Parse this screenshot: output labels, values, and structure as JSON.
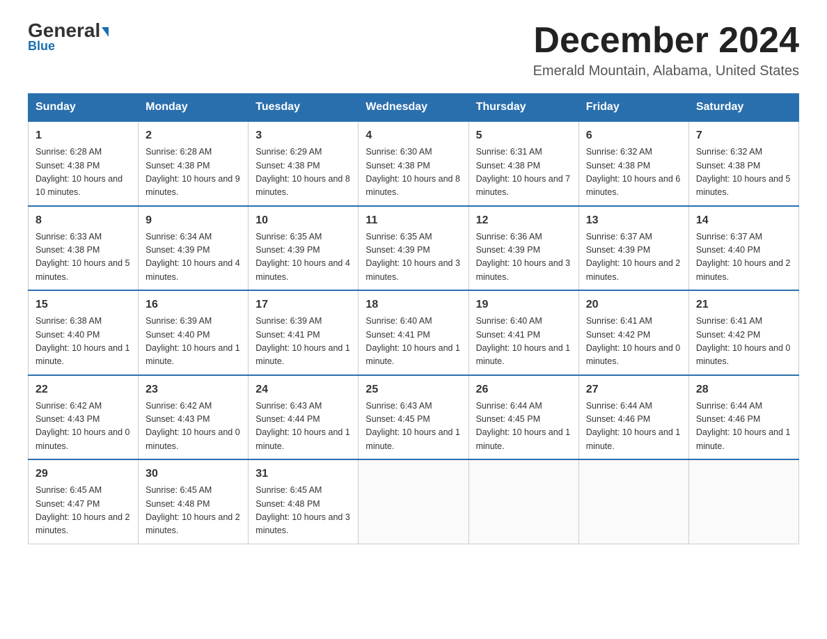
{
  "logo": {
    "general": "General",
    "triangle": "▶",
    "blue": "Blue"
  },
  "header": {
    "month_year": "December 2024",
    "location": "Emerald Mountain, Alabama, United States"
  },
  "days_of_week": [
    "Sunday",
    "Monday",
    "Tuesday",
    "Wednesday",
    "Thursday",
    "Friday",
    "Saturday"
  ],
  "weeks": [
    [
      {
        "day": "1",
        "sunrise": "6:28 AM",
        "sunset": "4:38 PM",
        "daylight": "10 hours and 10 minutes."
      },
      {
        "day": "2",
        "sunrise": "6:28 AM",
        "sunset": "4:38 PM",
        "daylight": "10 hours and 9 minutes."
      },
      {
        "day": "3",
        "sunrise": "6:29 AM",
        "sunset": "4:38 PM",
        "daylight": "10 hours and 8 minutes."
      },
      {
        "day": "4",
        "sunrise": "6:30 AM",
        "sunset": "4:38 PM",
        "daylight": "10 hours and 8 minutes."
      },
      {
        "day": "5",
        "sunrise": "6:31 AM",
        "sunset": "4:38 PM",
        "daylight": "10 hours and 7 minutes."
      },
      {
        "day": "6",
        "sunrise": "6:32 AM",
        "sunset": "4:38 PM",
        "daylight": "10 hours and 6 minutes."
      },
      {
        "day": "7",
        "sunrise": "6:32 AM",
        "sunset": "4:38 PM",
        "daylight": "10 hours and 5 minutes."
      }
    ],
    [
      {
        "day": "8",
        "sunrise": "6:33 AM",
        "sunset": "4:38 PM",
        "daylight": "10 hours and 5 minutes."
      },
      {
        "day": "9",
        "sunrise": "6:34 AM",
        "sunset": "4:39 PM",
        "daylight": "10 hours and 4 minutes."
      },
      {
        "day": "10",
        "sunrise": "6:35 AM",
        "sunset": "4:39 PM",
        "daylight": "10 hours and 4 minutes."
      },
      {
        "day": "11",
        "sunrise": "6:35 AM",
        "sunset": "4:39 PM",
        "daylight": "10 hours and 3 minutes."
      },
      {
        "day": "12",
        "sunrise": "6:36 AM",
        "sunset": "4:39 PM",
        "daylight": "10 hours and 3 minutes."
      },
      {
        "day": "13",
        "sunrise": "6:37 AM",
        "sunset": "4:39 PM",
        "daylight": "10 hours and 2 minutes."
      },
      {
        "day": "14",
        "sunrise": "6:37 AM",
        "sunset": "4:40 PM",
        "daylight": "10 hours and 2 minutes."
      }
    ],
    [
      {
        "day": "15",
        "sunrise": "6:38 AM",
        "sunset": "4:40 PM",
        "daylight": "10 hours and 1 minute."
      },
      {
        "day": "16",
        "sunrise": "6:39 AM",
        "sunset": "4:40 PM",
        "daylight": "10 hours and 1 minute."
      },
      {
        "day": "17",
        "sunrise": "6:39 AM",
        "sunset": "4:41 PM",
        "daylight": "10 hours and 1 minute."
      },
      {
        "day": "18",
        "sunrise": "6:40 AM",
        "sunset": "4:41 PM",
        "daylight": "10 hours and 1 minute."
      },
      {
        "day": "19",
        "sunrise": "6:40 AM",
        "sunset": "4:41 PM",
        "daylight": "10 hours and 1 minute."
      },
      {
        "day": "20",
        "sunrise": "6:41 AM",
        "sunset": "4:42 PM",
        "daylight": "10 hours and 0 minutes."
      },
      {
        "day": "21",
        "sunrise": "6:41 AM",
        "sunset": "4:42 PM",
        "daylight": "10 hours and 0 minutes."
      }
    ],
    [
      {
        "day": "22",
        "sunrise": "6:42 AM",
        "sunset": "4:43 PM",
        "daylight": "10 hours and 0 minutes."
      },
      {
        "day": "23",
        "sunrise": "6:42 AM",
        "sunset": "4:43 PM",
        "daylight": "10 hours and 0 minutes."
      },
      {
        "day": "24",
        "sunrise": "6:43 AM",
        "sunset": "4:44 PM",
        "daylight": "10 hours and 1 minute."
      },
      {
        "day": "25",
        "sunrise": "6:43 AM",
        "sunset": "4:45 PM",
        "daylight": "10 hours and 1 minute."
      },
      {
        "day": "26",
        "sunrise": "6:44 AM",
        "sunset": "4:45 PM",
        "daylight": "10 hours and 1 minute."
      },
      {
        "day": "27",
        "sunrise": "6:44 AM",
        "sunset": "4:46 PM",
        "daylight": "10 hours and 1 minute."
      },
      {
        "day": "28",
        "sunrise": "6:44 AM",
        "sunset": "4:46 PM",
        "daylight": "10 hours and 1 minute."
      }
    ],
    [
      {
        "day": "29",
        "sunrise": "6:45 AM",
        "sunset": "4:47 PM",
        "daylight": "10 hours and 2 minutes."
      },
      {
        "day": "30",
        "sunrise": "6:45 AM",
        "sunset": "4:48 PM",
        "daylight": "10 hours and 2 minutes."
      },
      {
        "day": "31",
        "sunrise": "6:45 AM",
        "sunset": "4:48 PM",
        "daylight": "10 hours and 3 minutes."
      },
      null,
      null,
      null,
      null
    ]
  ],
  "labels": {
    "sunrise": "Sunrise:",
    "sunset": "Sunset:",
    "daylight": "Daylight:"
  }
}
